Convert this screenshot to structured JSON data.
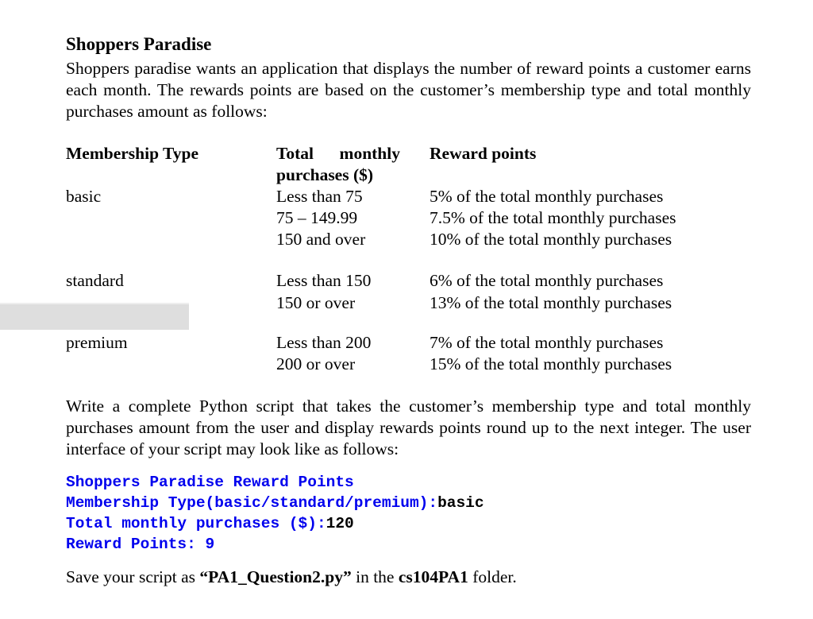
{
  "document": {
    "title": "Shoppers Paradise",
    "intro": "Shoppers paradise wants an application that displays the number of reward points a customer earns each month. The rewards points are based on the customer’s membership type and total monthly purchases amount as follows:",
    "table": {
      "headers": {
        "membership_type": "Membership Type",
        "total_monthly_purchases": "Total monthly purchases ($)",
        "reward_points": "Reward points"
      },
      "groups": [
        {
          "membership": "basic",
          "rows": [
            {
              "range": "Less than 75",
              "reward": "5% of the total monthly purchases"
            },
            {
              "range": "75 – 149.99",
              "reward": "7.5% of the total monthly purchases"
            },
            {
              "range": "150 and over",
              "reward": "10% of the total monthly purchases"
            }
          ]
        },
        {
          "membership": "standard",
          "rows": [
            {
              "range": "Less than 150",
              "reward": "6% of the total monthly purchases"
            },
            {
              "range": "150 or over",
              "reward": "13% of the total monthly purchases"
            }
          ]
        },
        {
          "membership": "premium",
          "rows": [
            {
              "range": "Less than 200",
              "reward": "7% of the total monthly purchases"
            },
            {
              "range": "200 or over",
              "reward": "15% of the total monthly purchases"
            }
          ]
        }
      ]
    },
    "instructions": "Write a complete Python script that takes the customer’s membership type and total monthly purchases amount from the user and display rewards points round up to the next integer. The user interface of your script may look like as follows:",
    "sample_output": {
      "line1": "Shoppers Paradise Reward Points",
      "line2_prompt": "Membership Type(basic/standard/premium):",
      "line2_input": "basic",
      "line3_prompt": "Total monthly purchases ($):",
      "line3_input": "120",
      "line4": "Reward Points: 9",
      "prompt_color": "#0000ee",
      "input_color": "#000000"
    },
    "save_note": {
      "prefix": "Save your script as ",
      "filename": "“PA1_Question2.py”",
      "middle": " in the ",
      "folder": "cs104PA1",
      "suffix": " folder."
    }
  }
}
